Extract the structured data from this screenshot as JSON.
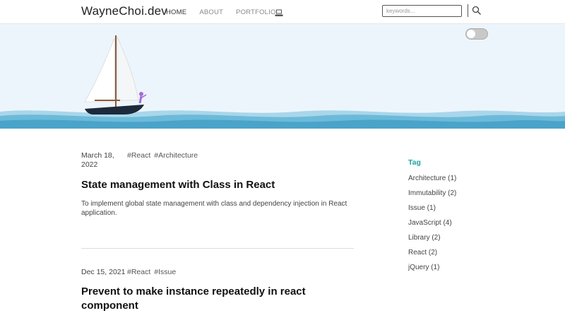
{
  "header": {
    "logo": "WayneChoi.dev",
    "nav": [
      {
        "label": "HOME"
      },
      {
        "label": "ABOUT"
      },
      {
        "label": "PORTFOLIO"
      }
    ],
    "nav_icon": "laptop-icon",
    "search": {
      "placeholder": "keywords...",
      "value": ""
    },
    "search_icon": "search-icon"
  },
  "hero": {
    "toggle_icon": "theme-toggle",
    "illustration": "sailboat-on-sea"
  },
  "posts": [
    {
      "date": "March 18, 2022",
      "tags": [
        "#React",
        "#Architecture"
      ],
      "title": "State management with Class in React",
      "description": "To implement global state management with class and dependency injection in React application."
    },
    {
      "date": "Dec 15, 2021",
      "tags": [
        "#React",
        "#Issue"
      ],
      "title": "Prevent to make instance repeatedly in react component",
      "description": ""
    }
  ],
  "sidebar": {
    "title": "Tag",
    "tags": [
      {
        "label": "Architecture (1)"
      },
      {
        "label": "Immutability (2)"
      },
      {
        "label": "Issue (1)"
      },
      {
        "label": "JavaScript (4)"
      },
      {
        "label": "Library (2)"
      },
      {
        "label": "React (2)"
      },
      {
        "label": "jQuery (1)"
      }
    ]
  },
  "colors": {
    "accent": "#1fa3a0",
    "sea": "#4aa3c9",
    "sky": "#edf5fc"
  }
}
